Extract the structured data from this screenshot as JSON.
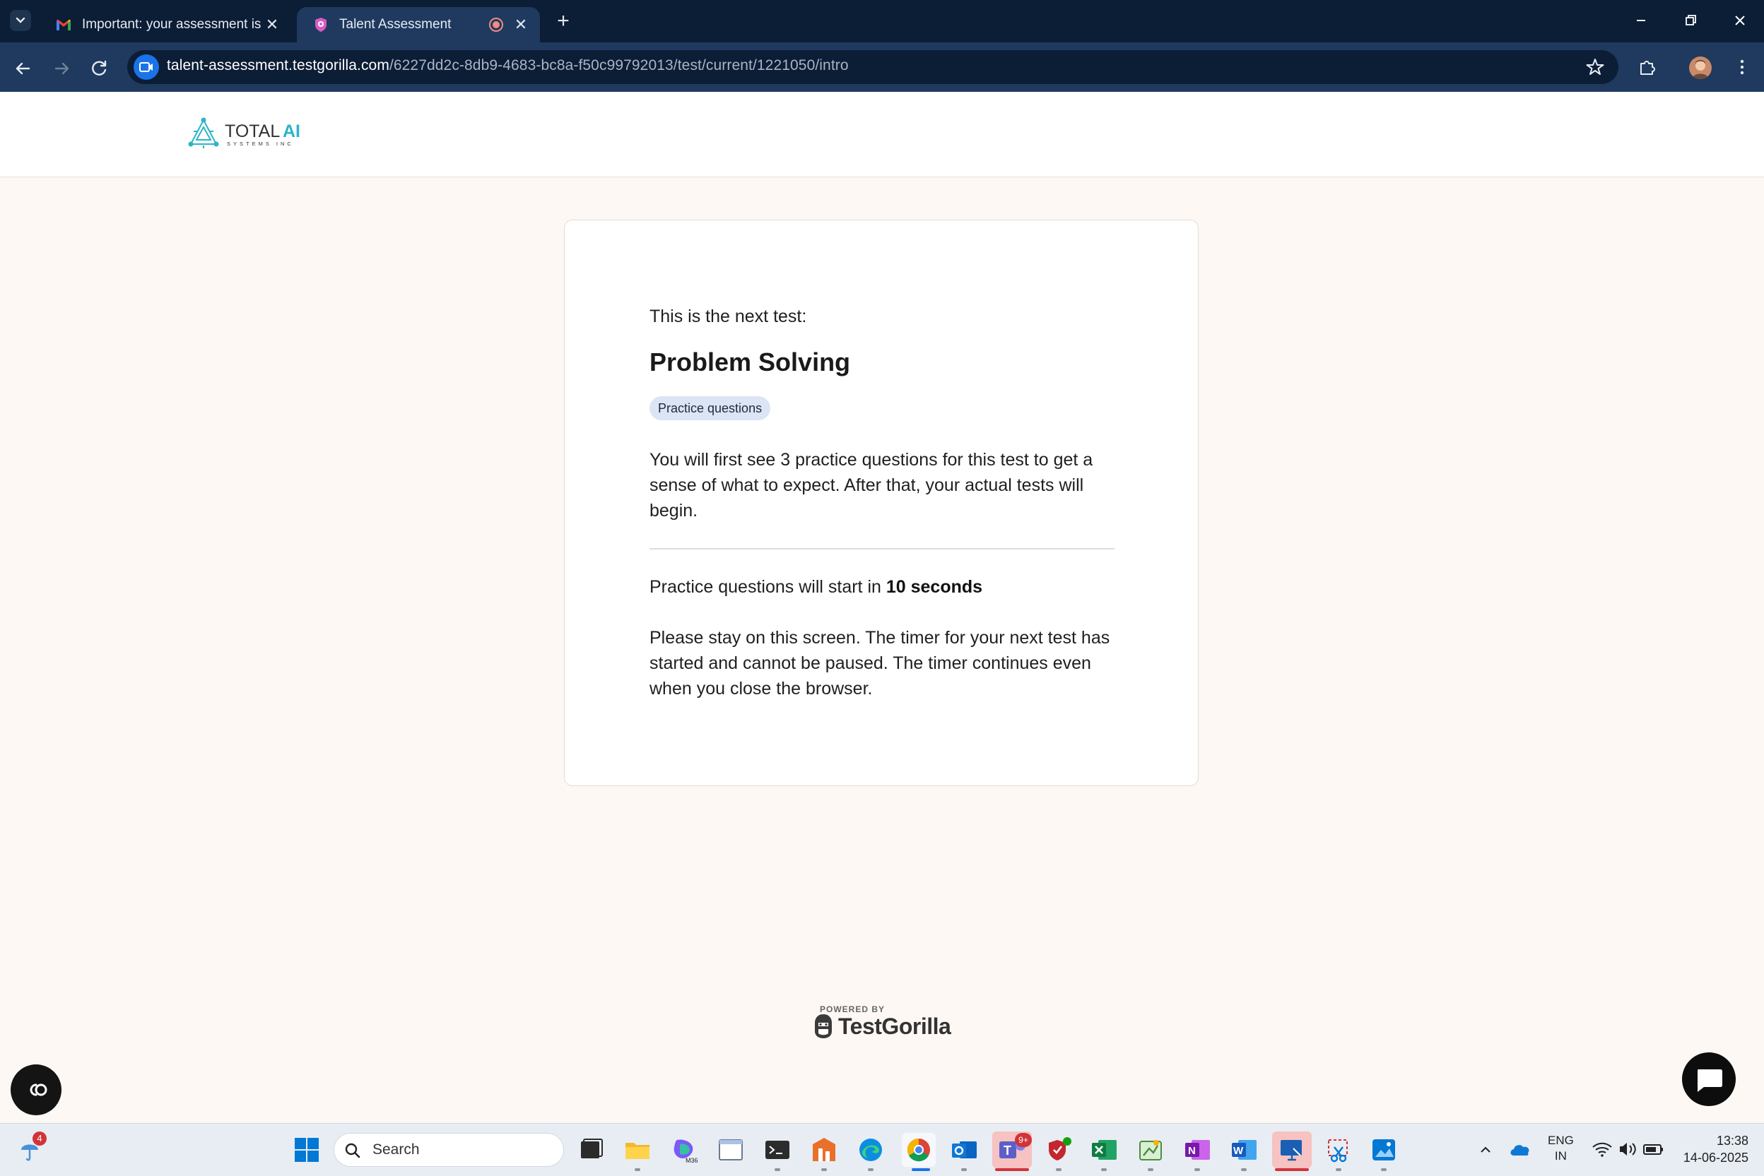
{
  "browser": {
    "tabs": [
      {
        "title": "Important: your assessment is w",
        "icon": "gmail-icon",
        "active": false
      },
      {
        "title": "Talent Assessment",
        "icon": "testgorilla-icon",
        "active": true
      }
    ],
    "url_host": "talent-assessment.testgorilla.com",
    "url_path": "/6227dd2c-8db9-4683-bc8a-f50c99792013/test/current/1221050/intro"
  },
  "header": {
    "logo_name_part1": "TOTAL",
    "logo_name_part2": "AI",
    "logo_tagline": "SYSTEMS INC"
  },
  "card": {
    "lead": "This is the next test:",
    "title": "Problem Solving",
    "badge": "Practice questions",
    "description": "You will first see 3 practice questions for this test to get a sense of what to expect. After that, your actual tests will begin.",
    "countdown_prefix": "Practice questions will start in ",
    "countdown_value": "10 seconds",
    "warning": "Please stay on this screen. The timer for your next test has started and cannot be paused. The timer continues even when you close the browser."
  },
  "footer": {
    "powered_by": "POWERED BY",
    "brand": "TestGorilla"
  },
  "taskbar": {
    "weather_badge": "4",
    "search_placeholder": "Search",
    "teams_badge": "9+",
    "lang_line1": "ENG",
    "lang_line2": "IN",
    "time": "13:38",
    "date": "14-06-2025"
  },
  "colors": {
    "brand_teal": "#2bb5c8",
    "page_bg": "#fdf8f4",
    "badge_bg": "#dbe5f6",
    "chrome_dark": "#0c1d36",
    "chrome_mid": "#1f3a5e"
  }
}
